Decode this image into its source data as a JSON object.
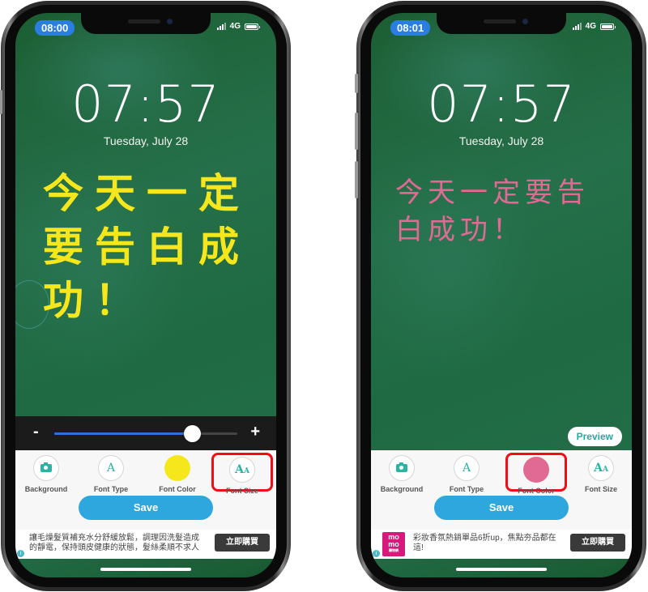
{
  "phones": [
    {
      "status_time": "08:00",
      "network": "4G",
      "lock_time": "07:57",
      "lock_date": "Tuesday, July 28",
      "message": "今天一定要告白成功！",
      "font_color": "#f5e71c",
      "font_size_slider": {
        "minus_label": "-",
        "plus_label": "+",
        "value_percent": 75
      },
      "toolbar": {
        "background_label": "Background",
        "font_type_label": "Font Type",
        "font_color_label": "Font Color",
        "font_size_label": "Font Size",
        "highlighted": "Font Size"
      },
      "save_label": "Save",
      "ad": {
        "text": "讓毛燥髮質補充水分舒緩放鬆，調理因洗髮造成的靜電，保持頭皮健康的狀態，髮絲柔順不求人",
        "button_label": "立即購買",
        "info_icon": "i"
      }
    },
    {
      "status_time": "08:01",
      "network": "4G",
      "lock_time": "07:57",
      "lock_date": "Tuesday, July 28",
      "message": "今天一定要告白成功！",
      "font_color": "#e06a93",
      "preview_label": "Preview",
      "toolbar": {
        "background_label": "Background",
        "font_type_label": "Font Type",
        "font_color_label": "Font Color",
        "font_size_label": "Font Size",
        "highlighted": "Font Color"
      },
      "save_label": "Save",
      "ad": {
        "logo_top": "mo",
        "logo_bottom": "mo",
        "logo_caption": "購物網",
        "text": "彩妝香氛熱銷單品6折up，焦點夯品都在這!",
        "button_label": "立即購買",
        "info_icon": "i"
      }
    }
  ],
  "colors": {
    "highlight_box": "#ef0d16",
    "accent_teal": "#2bb3a3",
    "save_button": "#2ea7df",
    "status_pill": "#2a7de1",
    "slider_fill": "#2f6fe0"
  }
}
